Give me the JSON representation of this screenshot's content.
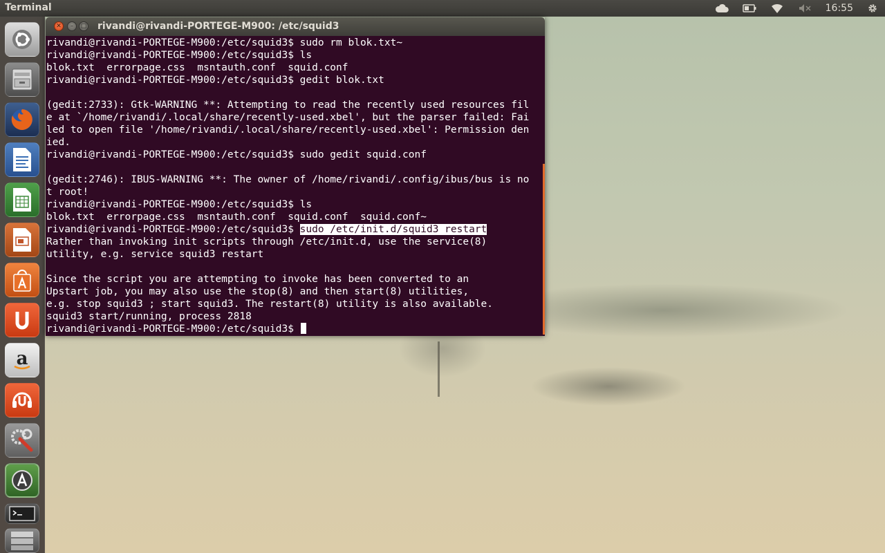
{
  "top_panel": {
    "app_title": "Terminal",
    "clock": "16:55",
    "icons": [
      "cloud-icon",
      "battery-icon",
      "wifi-icon",
      "volume-muted-icon",
      "gear-icon"
    ]
  },
  "launcher": {
    "items": [
      {
        "name": "ubuntu-dash",
        "icon": "ubuntu-logo-icon"
      },
      {
        "name": "files",
        "icon": "file-cabinet-icon"
      },
      {
        "name": "firefox",
        "icon": "firefox-icon"
      },
      {
        "name": "libreoffice-writer",
        "icon": "writer-icon"
      },
      {
        "name": "libreoffice-calc",
        "icon": "calc-icon"
      },
      {
        "name": "libreoffice-impress",
        "icon": "impress-icon"
      },
      {
        "name": "software-center",
        "icon": "shopping-bag-icon"
      },
      {
        "name": "ubuntu-one",
        "icon": "ubuntu-one-icon"
      },
      {
        "name": "amazon",
        "icon": "amazon-icon"
      },
      {
        "name": "ubuntu-one-music",
        "icon": "music-icon"
      },
      {
        "name": "system-settings",
        "icon": "wrench-icon"
      },
      {
        "name": "software-updater",
        "icon": "update-icon"
      },
      {
        "name": "terminal",
        "icon": "terminal-icon"
      },
      {
        "name": "workspace-switcher",
        "icon": "stack-icon"
      }
    ]
  },
  "terminal": {
    "window_title": "rivandi@rivandi-PORTEGE-M900: /etc/squid3",
    "colors": {
      "background": "#300a24",
      "text": "#ffffff",
      "scrollbar": "#e36b2c"
    },
    "lines": [
      "rivandi@rivandi-PORTEGE-M900:/etc/squid3$ sudo rm blok.txt~",
      "rivandi@rivandi-PORTEGE-M900:/etc/squid3$ ls",
      "blok.txt  errorpage.css  msntauth.conf  squid.conf",
      "rivandi@rivandi-PORTEGE-M900:/etc/squid3$ gedit blok.txt",
      "",
      "(gedit:2733): Gtk-WARNING **: Attempting to read the recently used resources fil",
      "e at `/home/rivandi/.local/share/recently-used.xbel', but the parser failed: Fai",
      "led to open file '/home/rivandi/.local/share/recently-used.xbel': Permission den",
      "ied.",
      "rivandi@rivandi-PORTEGE-M900:/etc/squid3$ sudo gedit squid.conf",
      "",
      "(gedit:2746): IBUS-WARNING **: The owner of /home/rivandi/.config/ibus/bus is no",
      "t root!",
      "rivandi@rivandi-PORTEGE-M900:/etc/squid3$ ls",
      "blok.txt  errorpage.css  msntauth.conf  squid.conf  squid.conf~",
      "rivandi@rivandi-PORTEGE-M900:/etc/squid3$ ",
      "Rather than invoking init scripts through /etc/init.d, use the service(8)",
      "utility, e.g. service squid3 restart",
      "",
      "Since the script you are attempting to invoke has been converted to an",
      "Upstart job, you may also use the stop(8) and then start(8) utilities,",
      "e.g. stop squid3 ; start squid3. The restart(8) utility is also available.",
      "squid3 start/running, process 2818",
      "rivandi@rivandi-PORTEGE-M900:/etc/squid3$ "
    ],
    "highlighted_command": "sudo /etc/init.d/squid3 restart"
  }
}
